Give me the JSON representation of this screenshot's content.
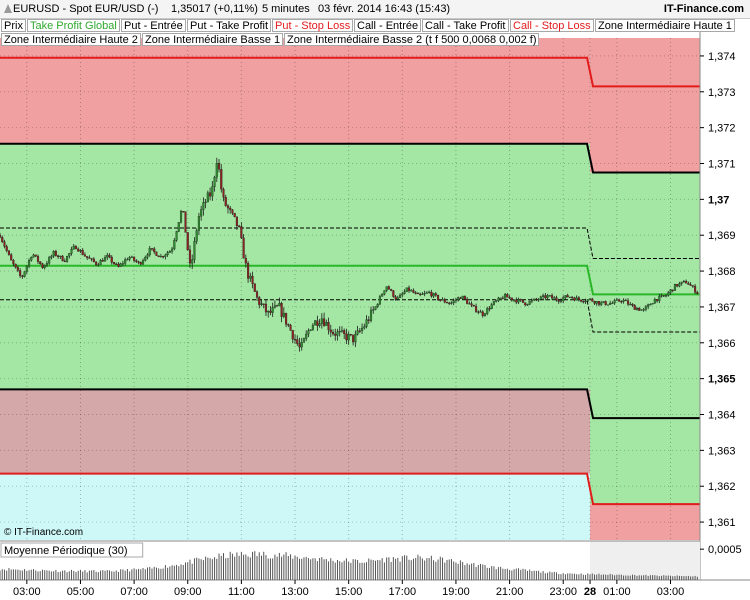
{
  "header": {
    "symbol": "EURUSD - Spot EUR/USD (-)",
    "quote": "1,35017 (+0,11%)",
    "interval": "5 minutes",
    "datetime": "03 févr. 2014 16:43 (15:43)",
    "brand": "IT-Finance.com"
  },
  "legend": {
    "row1": [
      {
        "label": "Prix",
        "color": "#000000"
      },
      {
        "label": "Take Profit Global",
        "color": "#2ea82e"
      },
      {
        "label": "Put - Entrée",
        "color": "#000000"
      },
      {
        "label": "Put - Take Profit",
        "color": "#000000"
      },
      {
        "label": "Put - Stop Loss",
        "color": "#e21b1b"
      },
      {
        "label": "Call - Entrée",
        "color": "#000000"
      },
      {
        "label": "Call - Take Profit",
        "color": "#000000"
      },
      {
        "label": "Call - Stop Loss",
        "color": "#e21b1b"
      },
      {
        "label": "Zone Intermédiaire Haute 1",
        "color": "#000000"
      }
    ],
    "row2": [
      {
        "label": "Zone Intermédiaire Haute 2",
        "color": "#000000"
      },
      {
        "label": "Zone Intermédiaire Basse 1",
        "color": "#000000"
      },
      {
        "label": "Zone Intermédiaire Basse 2 (t f 500 0,0068 0,002 f)",
        "color": "#000000"
      }
    ]
  },
  "watermark": "© IT-Finance.com",
  "indicator": {
    "label": "Moyenne Périodique (30)",
    "tick": "0,0005"
  },
  "colors": {
    "red_zone": "#f0a0a0",
    "green_zone": "#a4e6a4",
    "mixed_zone": "#d4a8a8",
    "cyan_zone": "#cef8f8",
    "red_line": "#e21b1b",
    "green_line": "#28b828",
    "candle_up": "#2e8b2e",
    "candle_down": "#8b2222"
  },
  "chart_data": {
    "type": "candlestick",
    "instrument": "EURUSD",
    "interval": "5 minutes",
    "ylim": [
      1.3605,
      1.3745
    ],
    "yticks": [
      {
        "v": 1.374,
        "label": "1,374",
        "bold": false
      },
      {
        "v": 1.373,
        "label": "1,373",
        "bold": false
      },
      {
        "v": 1.372,
        "label": "1,372",
        "bold": false
      },
      {
        "v": 1.371,
        "label": "1,371",
        "bold": false
      },
      {
        "v": 1.37,
        "label": "1,37",
        "bold": true
      },
      {
        "v": 1.369,
        "label": "1,369",
        "bold": false
      },
      {
        "v": 1.368,
        "label": "1,368",
        "bold": false
      },
      {
        "v": 1.367,
        "label": "1,367",
        "bold": false
      },
      {
        "v": 1.366,
        "label": "1,366",
        "bold": false
      },
      {
        "v": 1.365,
        "label": "1,365",
        "bold": true
      },
      {
        "v": 1.364,
        "label": "1,364",
        "bold": false
      },
      {
        "v": 1.363,
        "label": "1,363",
        "bold": false
      },
      {
        "v": 1.362,
        "label": "1,362",
        "bold": false
      },
      {
        "v": 1.361,
        "label": "1,361",
        "bold": false
      }
    ],
    "xlim": [
      2.0,
      28.1
    ],
    "xticks": [
      {
        "t": 3,
        "label": "03:00",
        "bold": false
      },
      {
        "t": 5,
        "label": "05:00",
        "bold": false
      },
      {
        "t": 7,
        "label": "07:00",
        "bold": false
      },
      {
        "t": 9,
        "label": "09:00",
        "bold": false
      },
      {
        "t": 11,
        "label": "11:00",
        "bold": false
      },
      {
        "t": 13,
        "label": "13:00",
        "bold": false
      },
      {
        "t": 15,
        "label": "15:00",
        "bold": false
      },
      {
        "t": 17,
        "label": "17:00",
        "bold": false
      },
      {
        "t": 19,
        "label": "19:00",
        "bold": false
      },
      {
        "t": 21,
        "label": "21:00",
        "bold": false
      },
      {
        "t": 23,
        "label": "23:00",
        "bold": false
      },
      {
        "t": 24,
        "label": "28",
        "bold": true
      },
      {
        "t": 25,
        "label": "01:00",
        "bold": false
      },
      {
        "t": 27,
        "label": "03:00",
        "bold": false
      }
    ],
    "day_break": 24,
    "levels_before": {
      "red_line_top": 1.37395,
      "black_upper": 1.37155,
      "take_profit_global": 1.36815,
      "dashed_upper": 1.3692,
      "dashed_lower": 1.3672,
      "black_lower": 1.3647,
      "red_line_bottom": 1.36235
    },
    "levels_after": {
      "red_line_top": 1.37315,
      "black_upper": 1.37075,
      "take_profit_global": 1.36735,
      "dashed_upper": 1.36835,
      "dashed_lower": 1.3663,
      "black_lower": 1.3639,
      "red_line_bottom": 1.3615
    },
    "price_points": [
      [
        2.0,
        1.369
      ],
      [
        2.4,
        1.3683
      ],
      [
        2.8,
        1.3678
      ],
      [
        3.2,
        1.3685
      ],
      [
        3.6,
        1.3681
      ],
      [
        4.0,
        1.3685
      ],
      [
        4.4,
        1.3683
      ],
      [
        4.8,
        1.3687
      ],
      [
        5.2,
        1.3684
      ],
      [
        5.6,
        1.3682
      ],
      [
        6.0,
        1.3684
      ],
      [
        6.4,
        1.3681
      ],
      [
        6.8,
        1.3684
      ],
      [
        7.2,
        1.3682
      ],
      [
        7.6,
        1.3686
      ],
      [
        8.0,
        1.3684
      ],
      [
        8.4,
        1.3686
      ],
      [
        8.8,
        1.3698
      ],
      [
        9.1,
        1.368
      ],
      [
        9.4,
        1.3695
      ],
      [
        9.7,
        1.37
      ],
      [
        9.9,
        1.3702
      ],
      [
        10.1,
        1.3712
      ],
      [
        10.3,
        1.37
      ],
      [
        10.6,
        1.3696
      ],
      [
        10.9,
        1.3692
      ],
      [
        11.2,
        1.368
      ],
      [
        11.6,
        1.3672
      ],
      [
        12.0,
        1.3668
      ],
      [
        12.4,
        1.367
      ],
      [
        12.8,
        1.3664
      ],
      [
        13.2,
        1.3658
      ],
      [
        13.6,
        1.3665
      ],
      [
        14.0,
        1.3667
      ],
      [
        14.4,
        1.3663
      ],
      [
        14.8,
        1.3662
      ],
      [
        15.2,
        1.3661
      ],
      [
        15.6,
        1.3665
      ],
      [
        16.0,
        1.367
      ],
      [
        16.4,
        1.3676
      ],
      [
        16.8,
        1.3672
      ],
      [
        17.2,
        1.3675
      ],
      [
        17.6,
        1.3673
      ],
      [
        18.0,
        1.3674
      ],
      [
        18.4,
        1.3672
      ],
      [
        18.8,
        1.3671
      ],
      [
        19.2,
        1.3673
      ],
      [
        19.6,
        1.367
      ],
      [
        20.0,
        1.3668
      ],
      [
        20.4,
        1.3671
      ],
      [
        20.8,
        1.3673
      ],
      [
        21.2,
        1.3672
      ],
      [
        21.6,
        1.3671
      ],
      [
        22.0,
        1.3672
      ],
      [
        22.4,
        1.3673
      ],
      [
        22.8,
        1.3672
      ],
      [
        23.2,
        1.3673
      ],
      [
        23.6,
        1.3672
      ],
      [
        24.0,
        1.3672
      ],
      [
        24.4,
        1.3671
      ],
      [
        24.8,
        1.3671
      ],
      [
        25.2,
        1.3672
      ],
      [
        25.6,
        1.367
      ],
      [
        26.0,
        1.3669
      ],
      [
        26.4,
        1.3672
      ],
      [
        26.8,
        1.3673
      ],
      [
        27.2,
        1.3676
      ],
      [
        27.6,
        1.3677
      ],
      [
        28.0,
        1.3674
      ]
    ],
    "indicator_points": [
      [
        2.0,
        0.00018
      ],
      [
        4.0,
        0.00015
      ],
      [
        6.0,
        0.00014
      ],
      [
        7.5,
        0.00018
      ],
      [
        8.5,
        0.00024
      ],
      [
        9.5,
        0.00033
      ],
      [
        10.5,
        0.0004
      ],
      [
        11.5,
        0.00042
      ],
      [
        12.5,
        0.0004
      ],
      [
        13.5,
        0.00036
      ],
      [
        14.5,
        0.00032
      ],
      [
        15.5,
        0.0003
      ],
      [
        16.5,
        0.00034
      ],
      [
        17.5,
        0.00036
      ],
      [
        18.5,
        0.00033
      ],
      [
        19.5,
        0.00026
      ],
      [
        20.5,
        0.0002
      ],
      [
        21.5,
        0.00016
      ],
      [
        22.5,
        0.00012
      ],
      [
        23.5,
        0.0001
      ],
      [
        24.5,
        9e-05
      ],
      [
        25.5,
        8e-05
      ],
      [
        26.5,
        7e-05
      ],
      [
        28.0,
        6e-05
      ]
    ]
  }
}
